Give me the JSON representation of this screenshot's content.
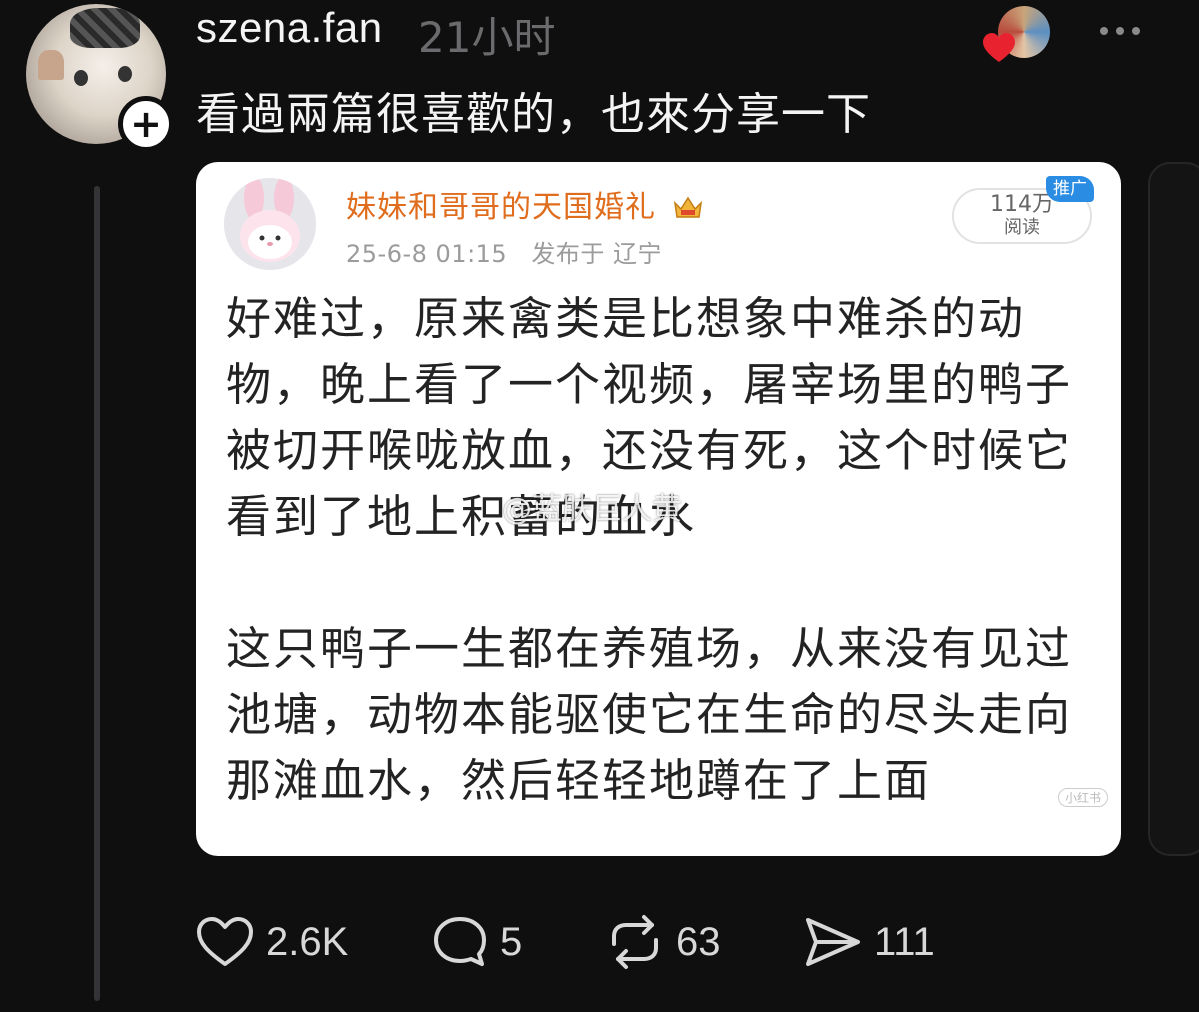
{
  "post": {
    "username": "szena.fan",
    "timestamp": "21小时",
    "text": "看過兩篇很喜歡的，也來分享一下"
  },
  "embedded_image": {
    "author": "妹妹和哥哥的天国婚礼",
    "date": "25-6-8 01:15",
    "location": "发布于 辽宁",
    "reads_count": "114万",
    "reads_label": "阅读",
    "ad_tag": "推广",
    "paragraphs": [
      "好难过，原来禽类是比想象中难杀的动物，晚上看了一个视频，屠宰场里的鸭子被切开喉咙放血，还没有死，这个时候它看到了地上积蓄的血水",
      "这只鸭子一生都在养殖场，从来没有见过池塘，动物本能驱使它在生命的尽头走向那滩血水，然后轻轻地蹲在了上面"
    ],
    "watermark": "@蓝肤巨人黄",
    "watermark_small": "小红书"
  },
  "actions": {
    "likes": "2.6K",
    "comments": "5",
    "reposts": "63",
    "shares": "111"
  },
  "icons": {
    "follow": "plus-icon",
    "more": "more-dots-icon",
    "like": "heart-icon",
    "comment": "comment-bubble-icon",
    "repost": "repost-icon",
    "share": "send-icon"
  },
  "colors": {
    "background": "#0f0f10",
    "author_orange": "#e06d1e",
    "ad_blue": "#2b8ce3",
    "heart_red": "#e8232f"
  }
}
